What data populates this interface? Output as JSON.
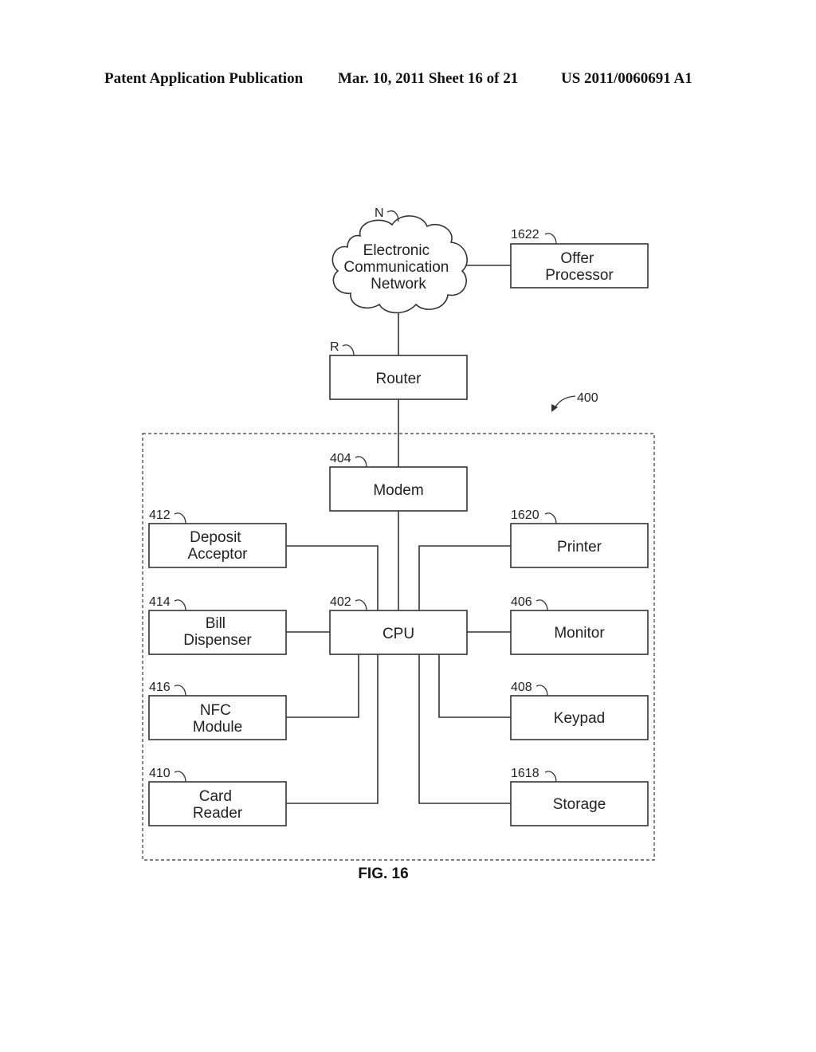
{
  "header": {
    "publication_type": "Patent Application Publication",
    "date_sheet": "Mar. 10, 2011  Sheet 16 of 21",
    "publication_number": "US 2011/0060691 A1"
  },
  "figure": {
    "label": "FIG. 16",
    "system_ref": "400",
    "network": {
      "ref": "N",
      "lines": [
        "Electronic",
        "Communication",
        "Network"
      ]
    },
    "offer_processor": {
      "ref": "1622",
      "lines": [
        "Offer",
        "Processor"
      ]
    },
    "router": {
      "ref": "R",
      "lines": [
        "Router"
      ]
    },
    "modem": {
      "ref": "404",
      "lines": [
        "Modem"
      ]
    },
    "cpu": {
      "ref": "402",
      "lines": [
        "CPU"
      ]
    },
    "deposit_acceptor": {
      "ref": "412",
      "lines": [
        "Deposit",
        "Acceptor"
      ]
    },
    "bill_dispenser": {
      "ref": "414",
      "lines": [
        "Bill",
        "Dispenser"
      ]
    },
    "nfc_module": {
      "ref": "416",
      "lines": [
        "NFC",
        "Module"
      ]
    },
    "card_reader": {
      "ref": "410",
      "lines": [
        "Card",
        "Reader"
      ]
    },
    "printer": {
      "ref": "1620",
      "lines": [
        "Printer"
      ]
    },
    "monitor": {
      "ref": "406",
      "lines": [
        "Monitor"
      ]
    },
    "keypad": {
      "ref": "408",
      "lines": [
        "Keypad"
      ]
    },
    "storage": {
      "ref": "1618",
      "lines": [
        "Storage"
      ]
    }
  }
}
